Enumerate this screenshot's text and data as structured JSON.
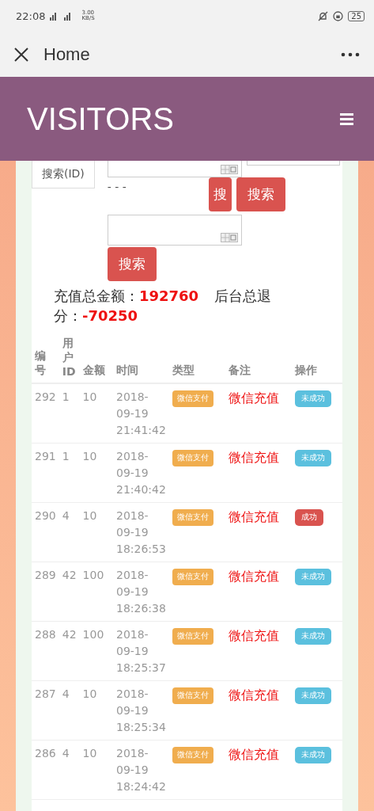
{
  "status_bar": {
    "time": "22:08",
    "speed": "3.00 KB/S",
    "battery": "25"
  },
  "nav": {
    "title": "Home"
  },
  "header": {
    "brand": "VISITORS"
  },
  "search": {
    "id_button": "搜索(ID)",
    "separator": "- - -",
    "buttons": [
      "搜",
      "搜索",
      "搜索"
    ]
  },
  "summary": {
    "recharge_label": "充值总金额：",
    "recharge_value": "192760",
    "refund_label": "后台总退分：",
    "refund_value": "-70250"
  },
  "table": {
    "columns": [
      "编号",
      "用户ID",
      "金额",
      "时间",
      "类型",
      "备注",
      "操作"
    ],
    "rows": [
      {
        "id": "292",
        "user_id": "1",
        "amount": "10",
        "time": "2018-09-19 21:41:42",
        "type": "微信支付",
        "note": "微信充值",
        "status": "未成功",
        "kind": "fail"
      },
      {
        "id": "291",
        "user_id": "1",
        "amount": "10",
        "time": "2018-09-19 21:40:42",
        "type": "微信支付",
        "note": "微信充值",
        "status": "未成功",
        "kind": "fail"
      },
      {
        "id": "290",
        "user_id": "4",
        "amount": "10",
        "time": "2018-09-19 18:26:53",
        "type": "微信支付",
        "note": "微信充值",
        "status": "成功",
        "kind": "success"
      },
      {
        "id": "289",
        "user_id": "42",
        "amount": "100",
        "time": "2018-09-19 18:26:38",
        "type": "微信支付",
        "note": "微信充值",
        "status": "未成功",
        "kind": "fail"
      },
      {
        "id": "288",
        "user_id": "42",
        "amount": "100",
        "time": "2018-09-19 18:25:37",
        "type": "微信支付",
        "note": "微信充值",
        "status": "未成功",
        "kind": "fail"
      },
      {
        "id": "287",
        "user_id": "4",
        "amount": "10",
        "time": "2018-09-19 18:25:34",
        "type": "微信支付",
        "note": "微信充值",
        "status": "未成功",
        "kind": "fail"
      },
      {
        "id": "286",
        "user_id": "4",
        "amount": "10",
        "time": "2018-09-19 18:24:42",
        "type": "微信支付",
        "note": "微信充值",
        "status": "未成功",
        "kind": "fail"
      }
    ]
  }
}
